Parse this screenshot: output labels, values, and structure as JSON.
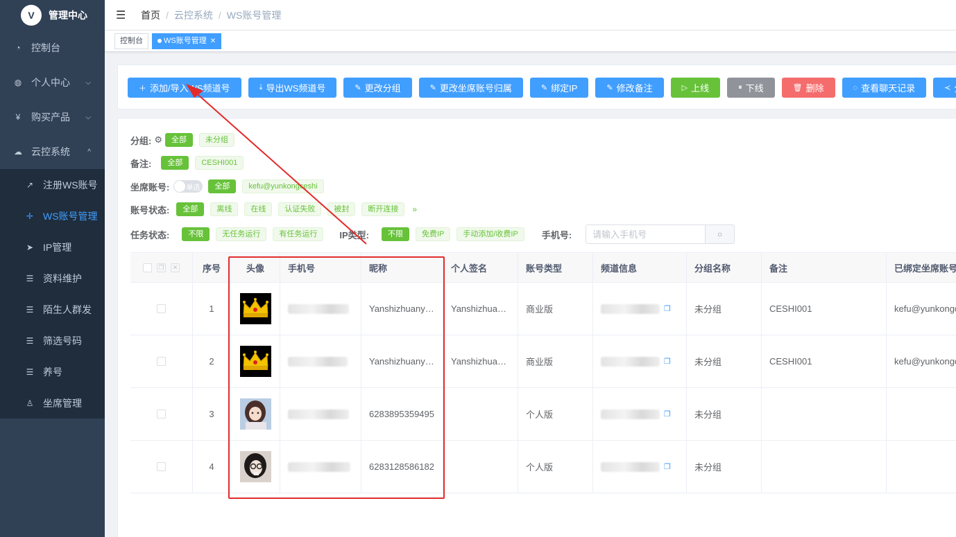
{
  "brand": {
    "name": "管理中心",
    "logo_glyph": "V"
  },
  "sidebar": {
    "items": [
      {
        "label": "控制台",
        "icon": "dashboard-icon"
      },
      {
        "label": "个人中心",
        "icon": "user-icon",
        "expandable": true
      },
      {
        "label": "购买产品",
        "icon": "yen-icon",
        "expandable": true
      },
      {
        "label": "云控系统",
        "icon": "cloud-icon",
        "expanded": true
      }
    ],
    "subitems": [
      {
        "label": "注册WS账号",
        "icon": "external-link-icon"
      },
      {
        "label": "WS账号管理",
        "icon": "move-icon",
        "active": true
      },
      {
        "label": "IP管理",
        "icon": "send-icon"
      },
      {
        "label": "资料维护",
        "icon": "sliders-icon"
      },
      {
        "label": "陌生人群发",
        "icon": "sliders-icon"
      },
      {
        "label": "筛选号码",
        "icon": "sliders-icon"
      },
      {
        "label": "养号",
        "icon": "sliders-icon"
      },
      {
        "label": "坐席管理",
        "icon": "person-icon"
      }
    ]
  },
  "navbar": {
    "breadcrumb": [
      "首页",
      "云控系统",
      "WS账号管理"
    ]
  },
  "tagsview": {
    "tags": [
      {
        "label": "控制台",
        "active": false
      },
      {
        "label": "WS账号管理",
        "active": true
      }
    ]
  },
  "toolbar": {
    "buttons": [
      {
        "label": "添加/导入WS频道号",
        "icon": "plus-icon",
        "color": "#409eff"
      },
      {
        "label": "导出WS频道号",
        "icon": "download-icon",
        "color": "#409eff"
      },
      {
        "label": "更改分组",
        "icon": "edit-icon",
        "color": "#409eff"
      },
      {
        "label": "更改坐席账号归属",
        "icon": "edit-icon",
        "color": "#409eff"
      },
      {
        "label": "绑定IP",
        "icon": "edit-icon",
        "color": "#409eff"
      },
      {
        "label": "修改备注",
        "icon": "edit-icon",
        "color": "#409eff"
      },
      {
        "label": "上线",
        "icon": "play-icon",
        "color": "#67c23a"
      },
      {
        "label": "下线",
        "icon": "pause-icon",
        "color": "#909399"
      },
      {
        "label": "删除",
        "icon": "trash-icon",
        "color": "#f56c6c"
      },
      {
        "label": "查看聊天记录",
        "icon": "chat-icon",
        "color": "#409eff"
      },
      {
        "label": "分享",
        "icon": "share-icon",
        "color": "#409eff"
      }
    ]
  },
  "filters": {
    "group": {
      "label": "分组:",
      "options": [
        "全部",
        "未分组"
      ]
    },
    "remark": {
      "label": "备注:",
      "options": [
        "全部",
        "CESHI001"
      ]
    },
    "seat": {
      "label": "坐席账号:",
      "switch_text": "单选",
      "options": [
        "全部",
        "kefu@yunkongceshi"
      ]
    },
    "status": {
      "label": "账号状态:",
      "options": [
        "全部",
        "离线",
        "在线",
        "认证失败",
        "被封",
        "断开连接"
      ]
    },
    "task": {
      "label": "任务状态:",
      "options": [
        "不限",
        "无任务运行",
        "有任务运行"
      ]
    },
    "ip": {
      "label": "IP类型:",
      "options": [
        "不限",
        "免费IP",
        "手动添加/收费IP"
      ]
    },
    "phone": {
      "label": "手机号:",
      "placeholder": "请输入手机号"
    }
  },
  "table": {
    "columns": [
      "序号",
      "头像",
      "手机号",
      "昵称",
      "个人签名",
      "账号类型",
      "频道信息",
      "分组名称",
      "备注",
      "已绑定坐席账号"
    ],
    "rows": [
      {
        "no": "1",
        "avatar": "crown-avatar",
        "nickname": "Yanshizhuany…",
        "signature": "Yanshizhuan…",
        "type": "商业版",
        "group": "未分组",
        "remark": "CESHI001",
        "seat": "kefu@yunkongc"
      },
      {
        "no": "2",
        "avatar": "crown-avatar",
        "nickname": "Yanshizhuany…",
        "signature": "Yanshizhuan…",
        "type": "商业版",
        "group": "未分组",
        "remark": "CESHI001",
        "seat": "kefu@yunkongc"
      },
      {
        "no": "3",
        "avatar": "girl-avatar",
        "nickname": "6283895359495",
        "signature": "",
        "type": "个人版",
        "group": "未分组",
        "remark": "",
        "seat": ""
      },
      {
        "no": "4",
        "avatar": "glasses-avatar",
        "nickname": "6283128586182",
        "signature": "",
        "type": "个人版",
        "group": "未分组",
        "remark": "",
        "seat": ""
      }
    ]
  },
  "colors": {
    "primary": "#409eff",
    "success": "#67c23a",
    "annotation": "#e32b2b",
    "sidebar": "#304156"
  }
}
